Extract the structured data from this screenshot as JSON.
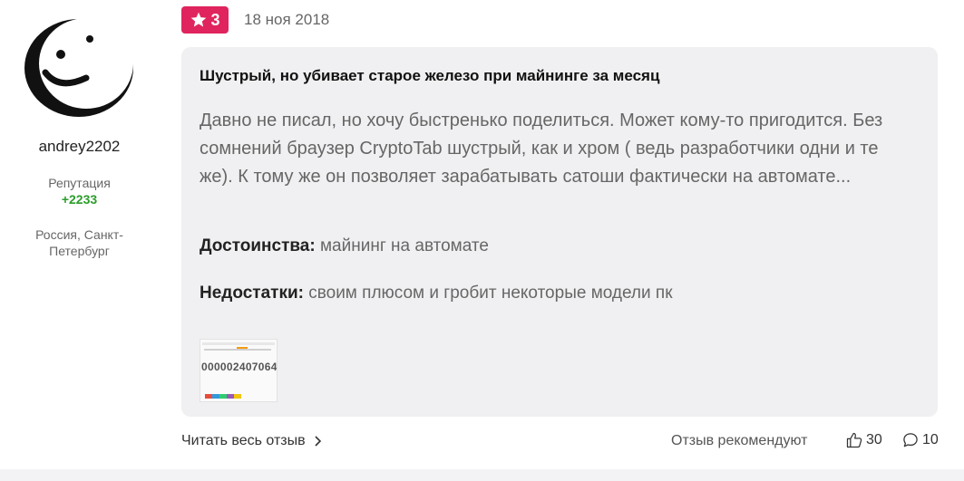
{
  "author": {
    "username": "andrey2202",
    "reputation_label": "Репутация",
    "reputation_value": "+2233",
    "location": "Россия, Санкт-Петербург"
  },
  "review": {
    "rating": "3",
    "date": "18 ноя 2018",
    "title": "Шустрый, но убивает старое железо при майнинге за месяц",
    "body": "Давно не писал, но хочу быстренько поделиться. Может кому-то пригодится. Без сомнений браузер CryptoTab шустрый, как и хром ( ведь разработчики одни и те же). К тому же он позволяет зарабатывать сатоши фактически на автомате...",
    "pros_label": "Достоинства:",
    "pros_text": "майнинг на автомате",
    "cons_label": "Недостатки:",
    "cons_text": "своим плюсом и гробит некоторые модели пк",
    "thumbnail_text": "000002407064"
  },
  "footer": {
    "read_more": "Читать весь отзыв",
    "recommend_label": "Отзыв рекомендуют",
    "likes_count": "30",
    "comments_count": "10"
  },
  "colors": {
    "rating_badge": "#e0245e",
    "reputation": "#2a9d2a",
    "card_bg": "#f0f0f2"
  },
  "icons": {
    "rating": "star-icon",
    "read_more": "chevron-right-icon",
    "likes": "thumbs-up-icon",
    "comments": "comment-bubble-icon"
  }
}
